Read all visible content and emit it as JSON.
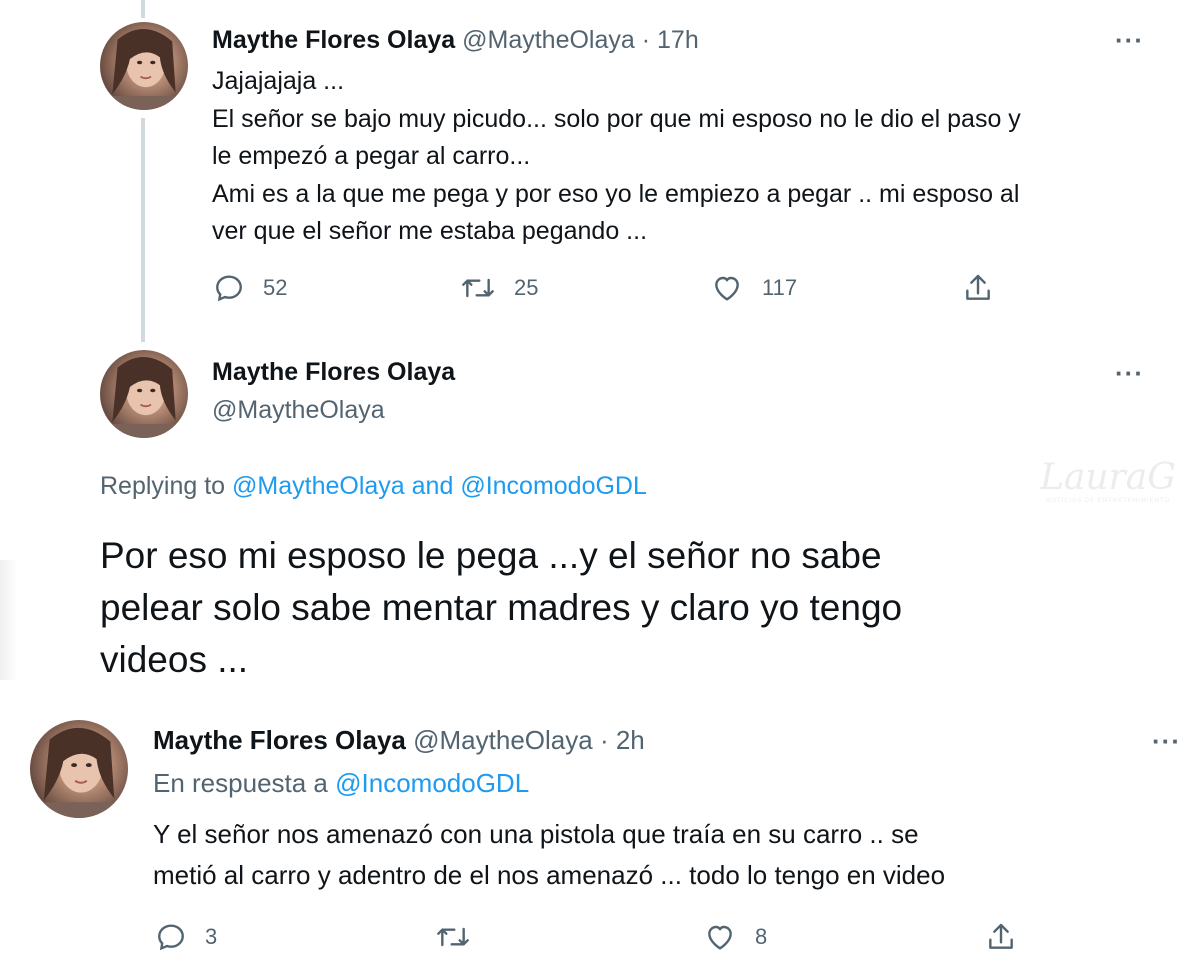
{
  "tweet1": {
    "name": "Maythe Flores Olaya",
    "handle": "@MaytheOlaya",
    "separator": "·",
    "time": "17h",
    "more": "···",
    "body": "Jajajajaja ...\nEl  señor  se  bajo  muy picudo... solo  por que mi  esposo no le dio el paso y\nle  empezó  a pegar al  carro...\nAmi es  a la que me pega   y por eso yo le empiezo a  pegar .. mi esposo al\nver   que el señor me estaba pegando ...",
    "replies": "52",
    "retweets": "25",
    "likes": "117"
  },
  "tweet2": {
    "name": "Maythe Flores Olaya",
    "handle": "@MaytheOlaya",
    "more": "···",
    "replying_prefix": "Replying to ",
    "replying_to_1": "@MaytheOlaya",
    "replying_and": " and ",
    "replying_to_2": "@IncomodoGDL",
    "body": "Por  eso mi  esposo  le  pega ...y el señor   no  sabe\npelear solo sabe mentar madres y  claro  yo  tengo\nvideos ..."
  },
  "tweet3": {
    "name": "Maythe Flores Olaya",
    "handle": "@MaytheOlaya",
    "separator": "·",
    "time": "2h",
    "more": "···",
    "replying_prefix": "En respuesta a ",
    "replying_to": "@IncomodoGDL",
    "body": "Y el  señor  nos  amenazó  con  una pistola  que  traía  en  su carro .. se\nmetió  al  carro   y adentro  de  el nos  amenazó  ... todo lo tengo  en  video",
    "replies": "3",
    "retweets": "",
    "likes": "8"
  },
  "watermark": {
    "main": "LauraG",
    "sub": "NOTICIAS DE ENTRETENIMIENTO"
  },
  "icons": [
    "reply-icon",
    "retweet-icon",
    "like-icon",
    "share-icon",
    "more-icon",
    "avatar"
  ],
  "colors": {
    "text": "#0f1419",
    "muted": "#536471",
    "link": "#1d9bf0",
    "thread_line": "#cfd9de"
  }
}
